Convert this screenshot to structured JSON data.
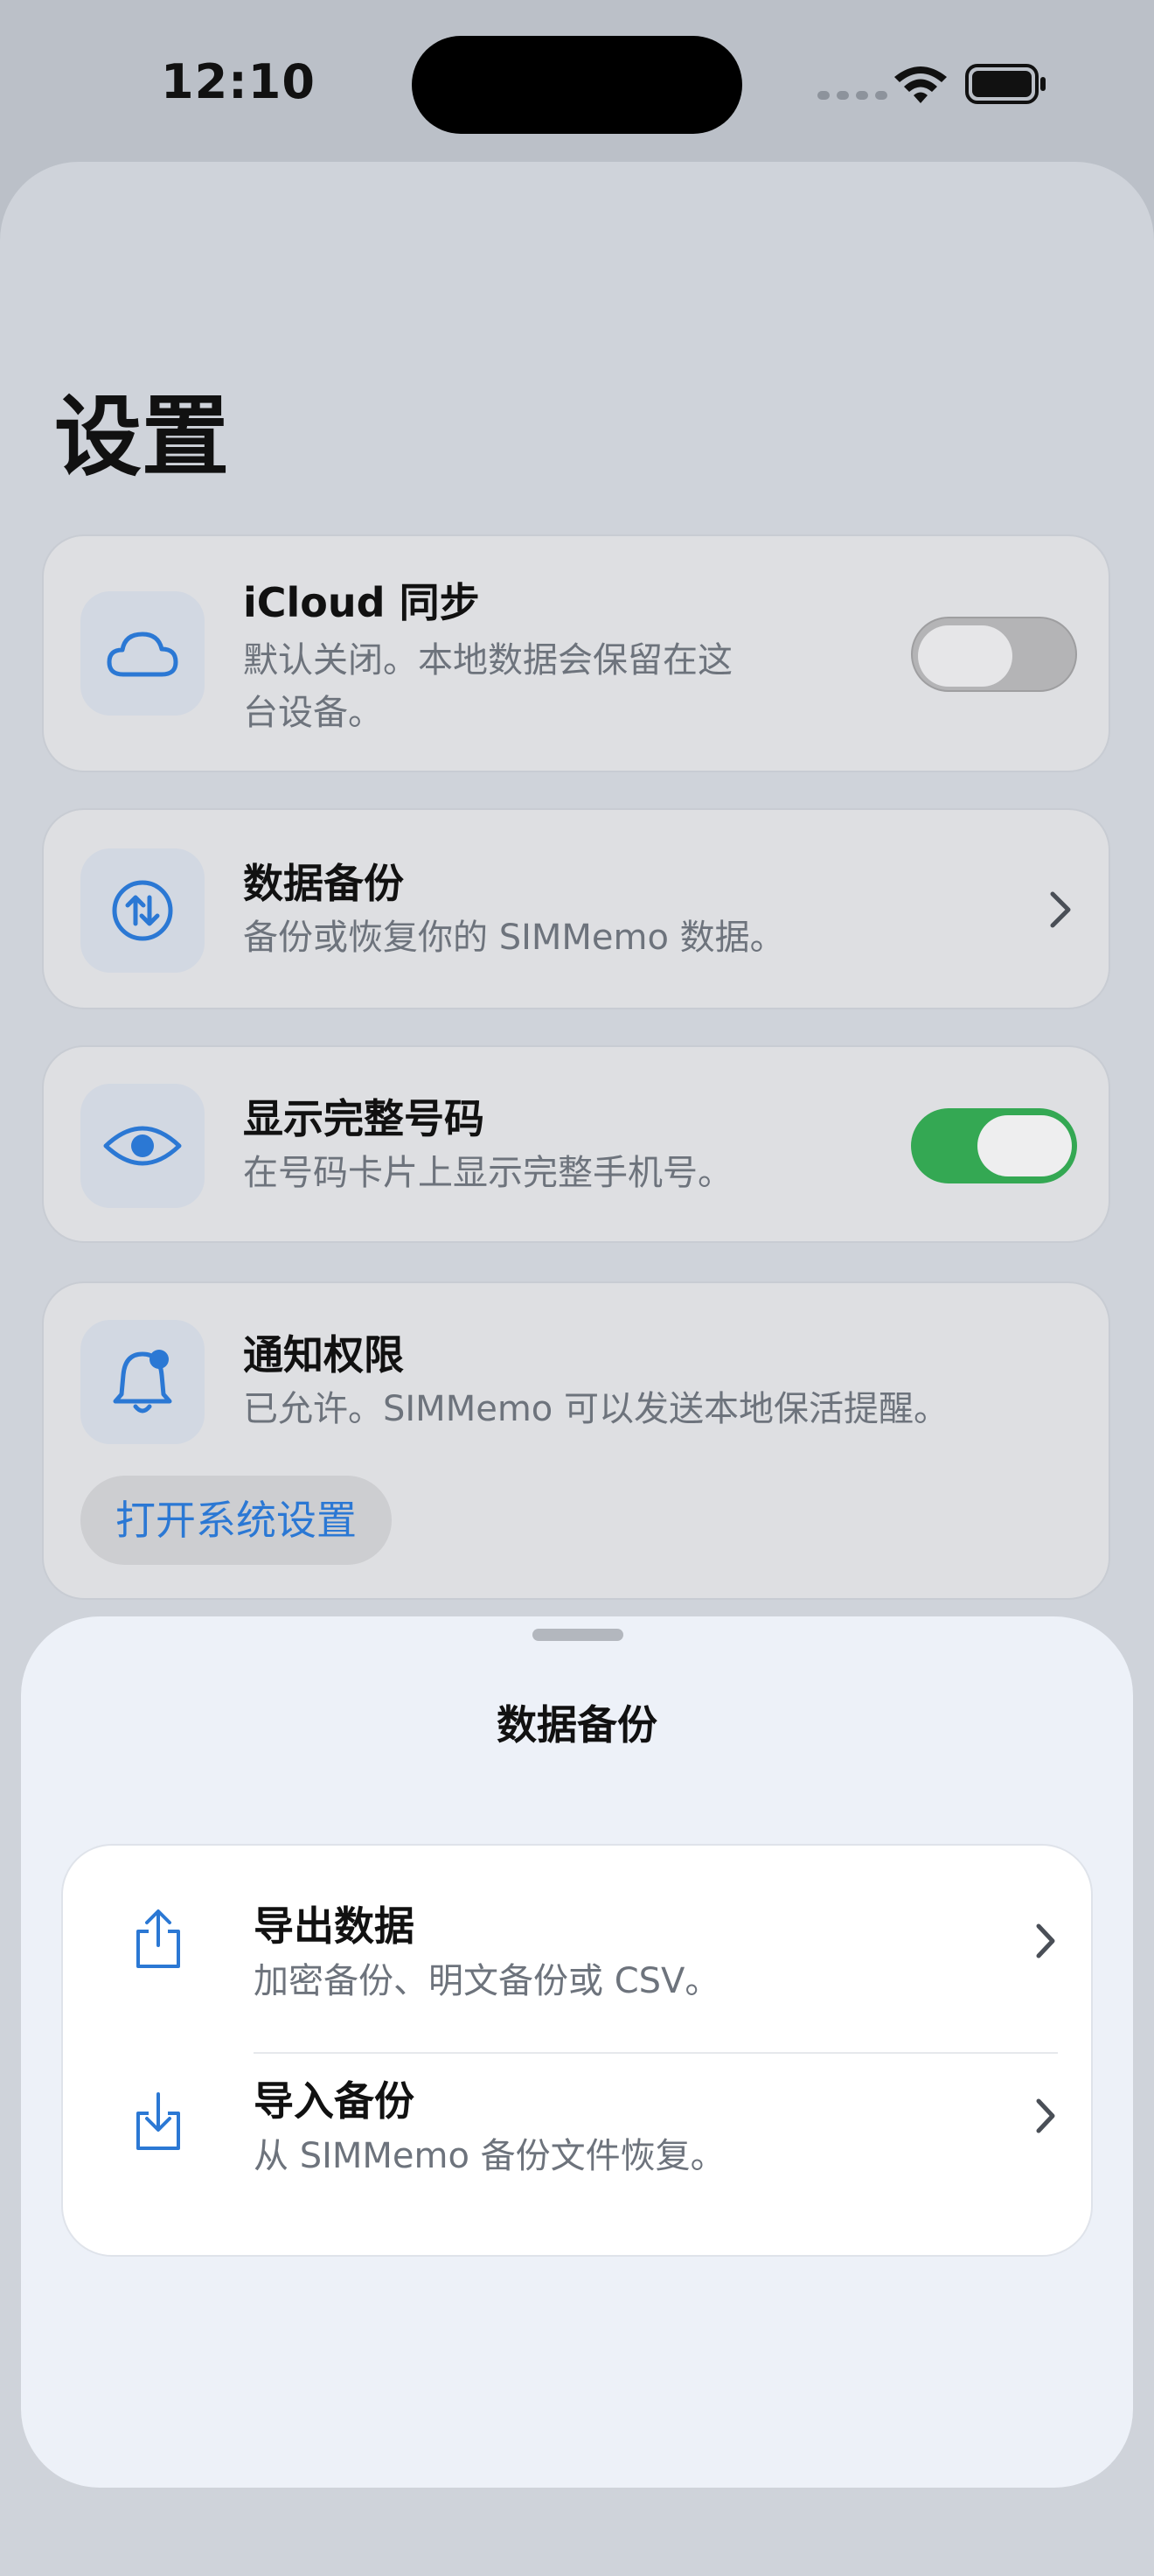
{
  "status_bar": {
    "time": "12:10"
  },
  "settings": {
    "title": "设置",
    "cards": {
      "icloud": {
        "title": "iCloud 同步",
        "desc_line1": "默认关闭。本地数据会保留在这",
        "desc_line2": "台设备。",
        "toggle": "off"
      },
      "backup": {
        "title": "数据备份",
        "desc": "备份或恢复你的 SIMMemo 数据。"
      },
      "show_number": {
        "title": "显示完整号码",
        "desc": "在号码卡片上显示完整手机号。",
        "toggle": "on"
      },
      "notification": {
        "title": "通知权限",
        "desc": "已允许。SIMMemo 可以发送本地保活提醒。",
        "button": "打开系统设置"
      }
    }
  },
  "sheet": {
    "title": "数据备份",
    "items": [
      {
        "title": "导出数据",
        "desc": "加密备份、明文备份或 CSV。",
        "icon": "share-export-icon"
      },
      {
        "title": "导入备份",
        "desc": "从 SIMMemo 备份文件恢复。",
        "icon": "import-icon"
      }
    ]
  },
  "colors": {
    "accent": "#2b78d4",
    "toggle_on": "#34a853",
    "toggle_off": "#b4b4b6"
  }
}
